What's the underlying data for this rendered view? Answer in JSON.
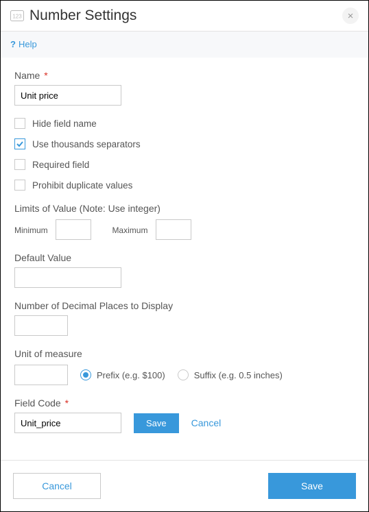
{
  "header": {
    "title": "Number Settings"
  },
  "help": {
    "label": "Help"
  },
  "fields": {
    "name": {
      "label": "Name",
      "required_mark": "*",
      "value": "Unit price"
    },
    "checkboxes": {
      "hide_field_name": {
        "label": "Hide field name",
        "checked": false
      },
      "thousands": {
        "label": "Use thousands separators",
        "checked": true
      },
      "required": {
        "label": "Required field",
        "checked": false
      },
      "prohibit_dup": {
        "label": "Prohibit duplicate values",
        "checked": false
      }
    },
    "limits": {
      "label": "Limits of Value (Note: Use integer)",
      "min_label": "Minimum",
      "max_label": "Maximum",
      "min_value": "",
      "max_value": ""
    },
    "default_value": {
      "label": "Default Value",
      "value": ""
    },
    "decimal_places": {
      "label": "Number of Decimal Places to Display",
      "value": ""
    },
    "unit_of_measure": {
      "label": "Unit of measure",
      "value": "",
      "prefix_label": "Prefix (e.g. $100)",
      "suffix_label": "Suffix (e.g. 0.5 inches)",
      "selected": "prefix"
    },
    "field_code": {
      "label": "Field Code",
      "required_mark": "*",
      "value": "Unit_price",
      "save_label": "Save",
      "cancel_label": "Cancel"
    }
  },
  "footer": {
    "cancel": "Cancel",
    "save": "Save"
  }
}
